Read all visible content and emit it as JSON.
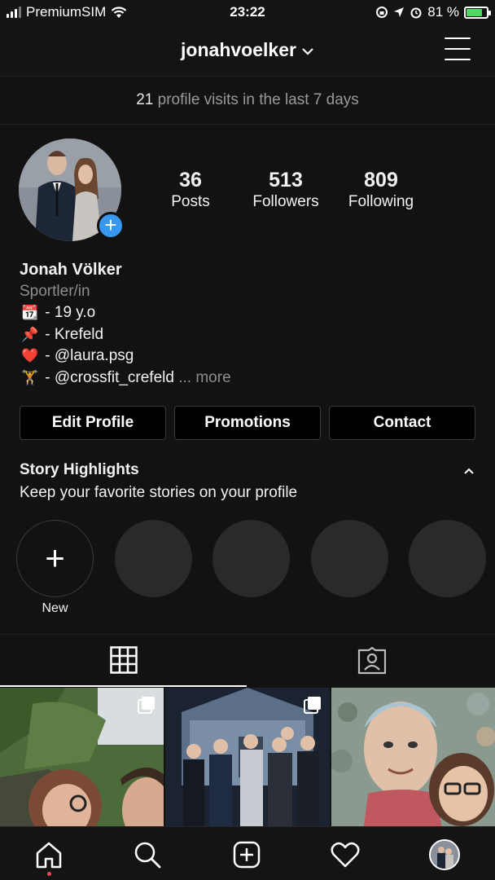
{
  "status_bar": {
    "carrier": "PremiumSIM",
    "time": "23:22",
    "battery_percent": "81 %",
    "battery_level": 0.81
  },
  "header": {
    "username": "jonahvoelker"
  },
  "visits": {
    "count": "21",
    "text": " profile visits in the last 7 days"
  },
  "profile": {
    "stats": [
      {
        "value": "36",
        "label": "Posts"
      },
      {
        "value": "513",
        "label": "Followers"
      },
      {
        "value": "809",
        "label": "Following"
      }
    ],
    "name": "Jonah Völker",
    "category": "Sportler/in",
    "bio_lines": [
      {
        "emoji": "📆",
        "text": " - 19 y.o"
      },
      {
        "emoji": "📌",
        "text": " - Krefeld"
      },
      {
        "emoji": "❤️",
        "text": " - @laura.psg"
      },
      {
        "emoji": "🏋️",
        "text": " - @crossfit_crefeld"
      }
    ],
    "more": " ... more"
  },
  "buttons": {
    "edit_profile": "Edit Profile",
    "promotions": "Promotions",
    "contact": "Contact"
  },
  "highlights": {
    "title": "Story Highlights",
    "subtitle": "Keep your favorite stories on your profile",
    "new_label": "New"
  },
  "colors": {
    "background": "#121212",
    "accent_blue": "#3897f0",
    "notification_red": "#ed4956",
    "battery_green": "#4cd964"
  },
  "icons": {
    "grid_tab": "grid-icon",
    "tagged_tab": "tagged-person-icon",
    "nav": [
      "home-icon",
      "search-icon",
      "add-post-icon",
      "heart-icon",
      "profile-avatar"
    ]
  }
}
